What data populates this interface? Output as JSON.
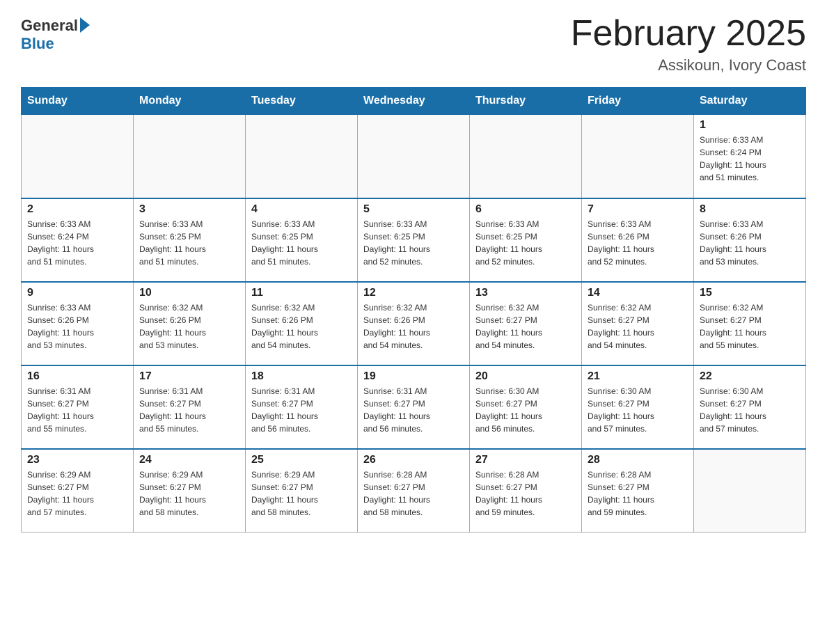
{
  "header": {
    "logo_general": "General",
    "logo_blue": "Blue",
    "month_title": "February 2025",
    "location": "Assikoun, Ivory Coast"
  },
  "weekdays": [
    "Sunday",
    "Monday",
    "Tuesday",
    "Wednesday",
    "Thursday",
    "Friday",
    "Saturday"
  ],
  "weeks": [
    [
      {
        "day": "",
        "info": ""
      },
      {
        "day": "",
        "info": ""
      },
      {
        "day": "",
        "info": ""
      },
      {
        "day": "",
        "info": ""
      },
      {
        "day": "",
        "info": ""
      },
      {
        "day": "",
        "info": ""
      },
      {
        "day": "1",
        "info": "Sunrise: 6:33 AM\nSunset: 6:24 PM\nDaylight: 11 hours\nand 51 minutes."
      }
    ],
    [
      {
        "day": "2",
        "info": "Sunrise: 6:33 AM\nSunset: 6:24 PM\nDaylight: 11 hours\nand 51 minutes."
      },
      {
        "day": "3",
        "info": "Sunrise: 6:33 AM\nSunset: 6:25 PM\nDaylight: 11 hours\nand 51 minutes."
      },
      {
        "day": "4",
        "info": "Sunrise: 6:33 AM\nSunset: 6:25 PM\nDaylight: 11 hours\nand 51 minutes."
      },
      {
        "day": "5",
        "info": "Sunrise: 6:33 AM\nSunset: 6:25 PM\nDaylight: 11 hours\nand 52 minutes."
      },
      {
        "day": "6",
        "info": "Sunrise: 6:33 AM\nSunset: 6:25 PM\nDaylight: 11 hours\nand 52 minutes."
      },
      {
        "day": "7",
        "info": "Sunrise: 6:33 AM\nSunset: 6:26 PM\nDaylight: 11 hours\nand 52 minutes."
      },
      {
        "day": "8",
        "info": "Sunrise: 6:33 AM\nSunset: 6:26 PM\nDaylight: 11 hours\nand 53 minutes."
      }
    ],
    [
      {
        "day": "9",
        "info": "Sunrise: 6:33 AM\nSunset: 6:26 PM\nDaylight: 11 hours\nand 53 minutes."
      },
      {
        "day": "10",
        "info": "Sunrise: 6:32 AM\nSunset: 6:26 PM\nDaylight: 11 hours\nand 53 minutes."
      },
      {
        "day": "11",
        "info": "Sunrise: 6:32 AM\nSunset: 6:26 PM\nDaylight: 11 hours\nand 54 minutes."
      },
      {
        "day": "12",
        "info": "Sunrise: 6:32 AM\nSunset: 6:26 PM\nDaylight: 11 hours\nand 54 minutes."
      },
      {
        "day": "13",
        "info": "Sunrise: 6:32 AM\nSunset: 6:27 PM\nDaylight: 11 hours\nand 54 minutes."
      },
      {
        "day": "14",
        "info": "Sunrise: 6:32 AM\nSunset: 6:27 PM\nDaylight: 11 hours\nand 54 minutes."
      },
      {
        "day": "15",
        "info": "Sunrise: 6:32 AM\nSunset: 6:27 PM\nDaylight: 11 hours\nand 55 minutes."
      }
    ],
    [
      {
        "day": "16",
        "info": "Sunrise: 6:31 AM\nSunset: 6:27 PM\nDaylight: 11 hours\nand 55 minutes."
      },
      {
        "day": "17",
        "info": "Sunrise: 6:31 AM\nSunset: 6:27 PM\nDaylight: 11 hours\nand 55 minutes."
      },
      {
        "day": "18",
        "info": "Sunrise: 6:31 AM\nSunset: 6:27 PM\nDaylight: 11 hours\nand 56 minutes."
      },
      {
        "day": "19",
        "info": "Sunrise: 6:31 AM\nSunset: 6:27 PM\nDaylight: 11 hours\nand 56 minutes."
      },
      {
        "day": "20",
        "info": "Sunrise: 6:30 AM\nSunset: 6:27 PM\nDaylight: 11 hours\nand 56 minutes."
      },
      {
        "day": "21",
        "info": "Sunrise: 6:30 AM\nSunset: 6:27 PM\nDaylight: 11 hours\nand 57 minutes."
      },
      {
        "day": "22",
        "info": "Sunrise: 6:30 AM\nSunset: 6:27 PM\nDaylight: 11 hours\nand 57 minutes."
      }
    ],
    [
      {
        "day": "23",
        "info": "Sunrise: 6:29 AM\nSunset: 6:27 PM\nDaylight: 11 hours\nand 57 minutes."
      },
      {
        "day": "24",
        "info": "Sunrise: 6:29 AM\nSunset: 6:27 PM\nDaylight: 11 hours\nand 58 minutes."
      },
      {
        "day": "25",
        "info": "Sunrise: 6:29 AM\nSunset: 6:27 PM\nDaylight: 11 hours\nand 58 minutes."
      },
      {
        "day": "26",
        "info": "Sunrise: 6:28 AM\nSunset: 6:27 PM\nDaylight: 11 hours\nand 58 minutes."
      },
      {
        "day": "27",
        "info": "Sunrise: 6:28 AM\nSunset: 6:27 PM\nDaylight: 11 hours\nand 59 minutes."
      },
      {
        "day": "28",
        "info": "Sunrise: 6:28 AM\nSunset: 6:27 PM\nDaylight: 11 hours\nand 59 minutes."
      },
      {
        "day": "",
        "info": ""
      }
    ]
  ]
}
